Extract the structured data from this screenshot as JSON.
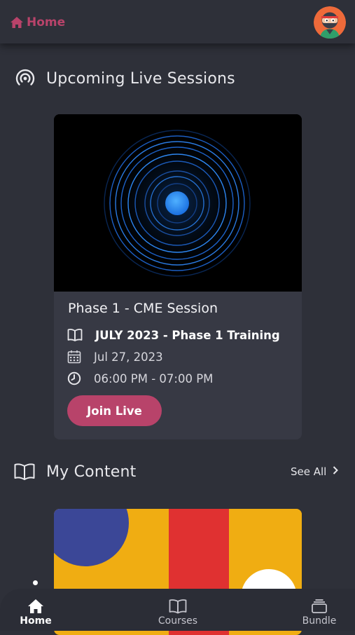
{
  "header": {
    "home_label": "Home",
    "home_icon": "house-icon",
    "avatar_icon": "ninja-avatar-icon",
    "accent_color": "#b8436a"
  },
  "live_sessions": {
    "section_title": "Upcoming Live Sessions",
    "section_icon": "broadcast-icon",
    "card": {
      "title": "Phase 1 - CME Session",
      "program": "JULY 2023 - Phase 1 Training",
      "date": "Jul 27, 2023",
      "time": "06:00 PM - 07:00 PM",
      "join_label": "Join Live"
    }
  },
  "my_content": {
    "section_title": "My Content",
    "section_icon": "open-book-icon",
    "see_all_label": "See All"
  },
  "bottom_nav": {
    "items": [
      {
        "label": "Home",
        "icon": "house-icon",
        "active": true
      },
      {
        "label": "Courses",
        "icon": "open-book-icon",
        "active": false
      },
      {
        "label": "Bundle",
        "icon": "stack-icon",
        "active": false
      }
    ]
  }
}
